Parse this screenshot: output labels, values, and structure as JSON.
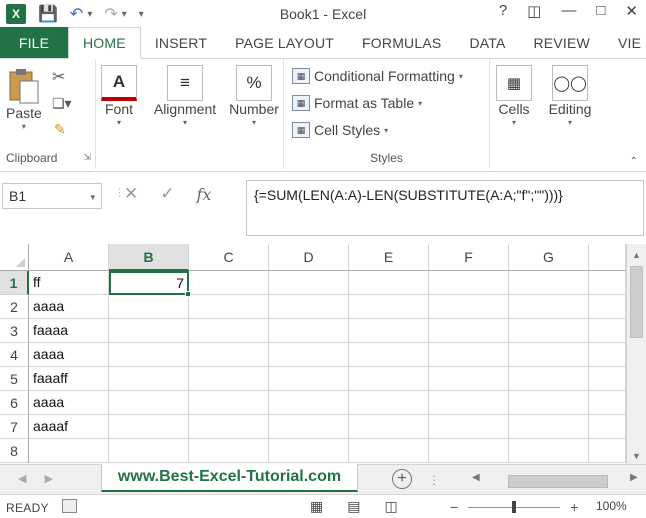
{
  "app": {
    "title": "Book1 - Excel",
    "logo": "X",
    "accent_color": "#217346"
  },
  "qat": {
    "save_icon": "save-icon",
    "undo_icon": "undo-icon",
    "redo_icon": "redo-icon",
    "customize_icon": "customize-qat-icon"
  },
  "window_buttons": [
    "?",
    "restore-ribbon",
    "minimize",
    "maximize",
    "close"
  ],
  "tabs": [
    "FILE",
    "HOME",
    "INSERT",
    "PAGE LAYOUT",
    "FORMULAS",
    "DATA",
    "REVIEW",
    "VIE"
  ],
  "active_tab": "HOME",
  "ribbon": {
    "clipboard": {
      "paste": "Paste",
      "label": "Clipboard"
    },
    "font": {
      "label": "Font"
    },
    "alignment": {
      "label": "Alignment"
    },
    "number": {
      "label": "Number",
      "glyph": "%"
    },
    "styles": {
      "conditional": "Conditional Formatting",
      "format_table": "Format as Table",
      "cell_styles": "Cell Styles",
      "label": "Styles"
    },
    "cells": {
      "label": "Cells"
    },
    "editing": {
      "label": "Editing"
    }
  },
  "formula_bar": {
    "name_box": "B1",
    "fx": "fx",
    "formula": "{=SUM(LEN(A:A)-LEN(SUBSTITUTE(A:A;\"f\";\"\")))}"
  },
  "columns": [
    "A",
    "B",
    "C",
    "D",
    "E",
    "F",
    "G"
  ],
  "selected_column": "B",
  "rows": [
    "1",
    "2",
    "3",
    "4",
    "5",
    "6",
    "7",
    "8"
  ],
  "selected_row": "1",
  "cells": {
    "A": [
      "ff",
      "aaaa",
      "faaaa",
      "aaaa",
      "faaaff",
      "aaaa",
      "aaaaf",
      ""
    ],
    "B1": "7"
  },
  "sheet": {
    "tab_label": "www.Best-Excel-Tutorial.com",
    "add_icon": "+"
  },
  "status": {
    "ready": "READY",
    "zoom": "100%",
    "zoom_minus": "−",
    "zoom_plus": "+"
  }
}
